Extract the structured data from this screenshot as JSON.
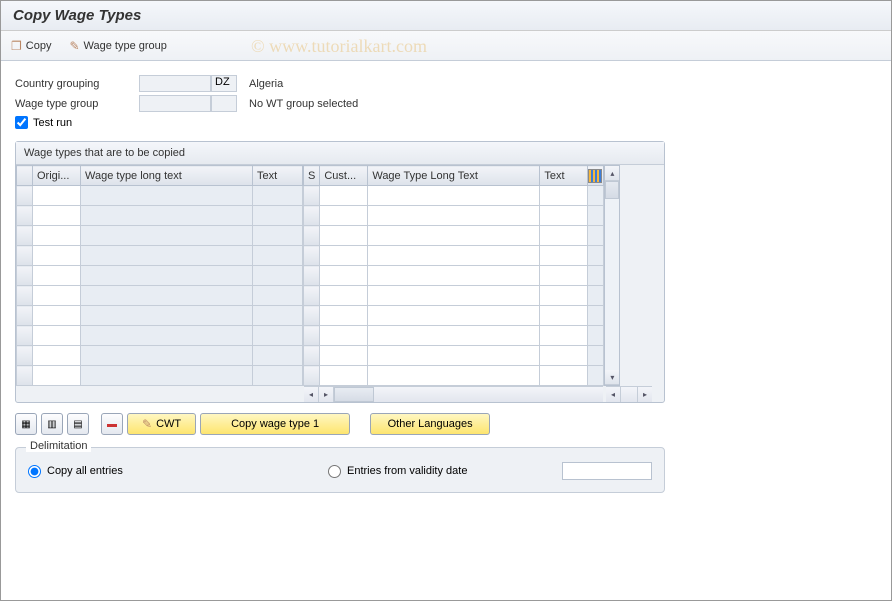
{
  "title": "Copy Wage Types",
  "watermark": "©  www.tutorialkart.com",
  "toolbar": {
    "copy_label": "Copy",
    "wtg_label": "Wage type group"
  },
  "form": {
    "country_label": "Country grouping",
    "country_code": "DZ",
    "country_name": "Algeria",
    "wtg_label": "Wage type group",
    "wtg_value": "",
    "wtg_text": "No WT group selected",
    "testrun_label": "Test run",
    "testrun_checked": true
  },
  "grid": {
    "title": "Wage types that are to be copied",
    "left_headers": [
      "Origi...",
      "Wage type long text",
      "Text"
    ],
    "right_headers": [
      "S",
      "Cust...",
      "Wage Type Long Text",
      "Text"
    ],
    "rows": 10
  },
  "buttons": {
    "cwt": "CWT",
    "copy1": "Copy wage type 1",
    "other_lang": "Other Languages"
  },
  "delimitation": {
    "legend": "Delimitation",
    "opt_all": "Copy all entries",
    "opt_from": "Entries from validity date",
    "date": ""
  }
}
